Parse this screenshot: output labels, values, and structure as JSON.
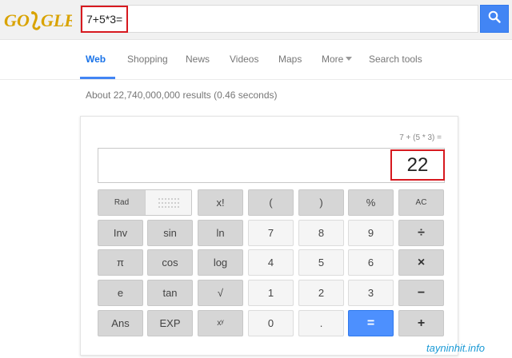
{
  "header": {
    "logo_text": "GOOGLE",
    "search_value": "7+5*3=",
    "search_button_icon": "search-icon"
  },
  "tabs": [
    {
      "label": "Web",
      "active": true
    },
    {
      "label": "Shopping"
    },
    {
      "label": "News"
    },
    {
      "label": "Videos"
    },
    {
      "label": "Maps"
    },
    {
      "label": "More"
    },
    {
      "label": "Search tools"
    }
  ],
  "result_stats": "About 22,740,000,000 results (0.46 seconds)",
  "calculator": {
    "history": "7 + (5 * 3) =",
    "result": "22",
    "rad_label": "Rad",
    "keys": {
      "factorial": "x!",
      "open_paren": "(",
      "close_paren": ")",
      "percent": "%",
      "clear": "AC",
      "inv": "Inv",
      "sin": "sin",
      "ln": "ln",
      "seven": "7",
      "eight": "8",
      "nine": "9",
      "divide": "÷",
      "pi": "π",
      "cos": "cos",
      "log": "log",
      "four": "4",
      "five": "5",
      "six": "6",
      "multiply": "×",
      "e": "e",
      "tan": "tan",
      "sqrt": "√",
      "one": "1",
      "two": "2",
      "three": "3",
      "minus": "−",
      "ans": "Ans",
      "exp": "EXP",
      "power": "xʸ",
      "zero": "0",
      "decimal": ".",
      "equals": "=",
      "plus": "+"
    }
  },
  "watermark": "tayninhit.info",
  "colors": {
    "accent_blue": "#4285f4",
    "highlight_red": "#d7191f",
    "logo_gold": "#d9a300"
  }
}
